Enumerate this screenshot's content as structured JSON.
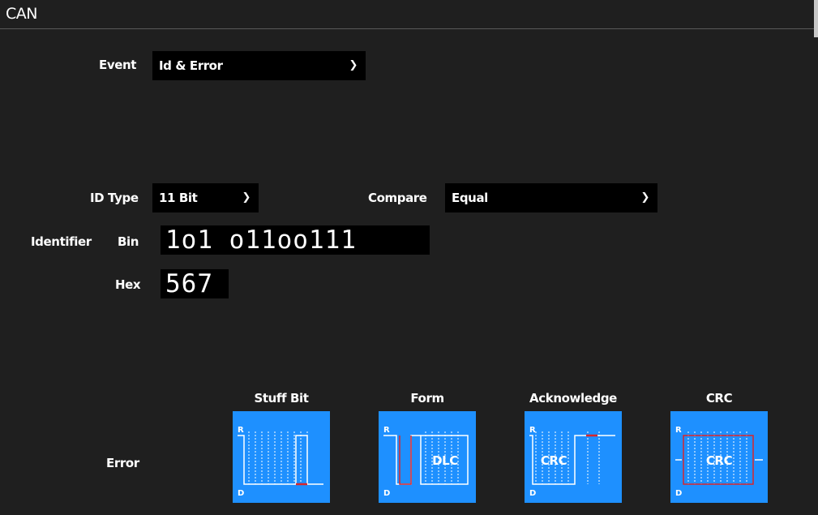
{
  "window": {
    "title": "CAN"
  },
  "event": {
    "label": "Event",
    "value": "Id & Error"
  },
  "id_type": {
    "label": "ID Type",
    "value": "11 Bit"
  },
  "compare": {
    "label": "Compare",
    "value": "Equal"
  },
  "identifier": {
    "label": "Identifier",
    "bin_label": "Bin",
    "bin_value": "1o1 o11oo111",
    "hex_label": "Hex",
    "hex_value": "567"
  },
  "error": {
    "label": "Error",
    "tiles": [
      {
        "title": "Stuff Bit",
        "icon": "stuff-bit-error-icon",
        "r": "R",
        "d": "D"
      },
      {
        "title": "Form",
        "icon": "form-error-icon",
        "r": "R",
        "d": "D",
        "text": "DLC"
      },
      {
        "title": "Acknowledge",
        "icon": "acknowledge-error-icon",
        "r": "R",
        "d": "D",
        "text": "CRC"
      },
      {
        "title": "CRC",
        "icon": "crc-error-icon",
        "r": "R",
        "d": "D",
        "text": "CRC"
      }
    ]
  },
  "colors": {
    "background": "#1f1f1f",
    "field": "#000000",
    "tile": "#1e90ff",
    "signal": "#ffffff",
    "error_highlight": "#d9262b"
  }
}
